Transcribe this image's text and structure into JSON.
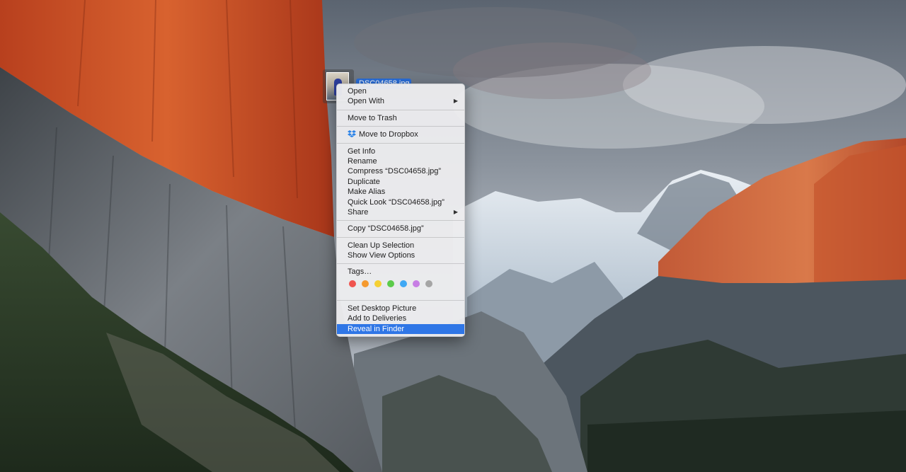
{
  "desktop": {
    "file_label": "DSC04658.jpg"
  },
  "context_menu": {
    "group1": [
      {
        "label": "Open",
        "arrow": ""
      },
      {
        "label": "Open With",
        "arrow": "▶"
      }
    ],
    "group2": [
      {
        "label": "Move to Trash"
      }
    ],
    "group3": [
      {
        "label": "Move to Dropbox",
        "icon": "dropbox-icon"
      }
    ],
    "group4": [
      {
        "label": "Get Info",
        "arrow": ""
      },
      {
        "label": "Rename",
        "arrow": ""
      },
      {
        "label": "Compress “DSC04658.jpg”",
        "arrow": ""
      },
      {
        "label": "Duplicate",
        "arrow": ""
      },
      {
        "label": "Make Alias",
        "arrow": ""
      },
      {
        "label": "Quick Look “DSC04658.jpg”",
        "arrow": ""
      },
      {
        "label": "Share",
        "arrow": "▶"
      }
    ],
    "group5": [
      {
        "label": "Copy “DSC04658.jpg”"
      }
    ],
    "group6": [
      {
        "label": "Clean Up Selection"
      },
      {
        "label": "Show View Options"
      }
    ],
    "group7": {
      "tags_label": "Tags…",
      "tag_colors": [
        "#f0544f",
        "#f59a2f",
        "#f5d033",
        "#5ccb4a",
        "#3fa8f4",
        "#c77ee4",
        "#a5a5a5"
      ]
    },
    "group8": [
      {
        "label": "Set Desktop Picture"
      },
      {
        "label": "Add to Deliveries"
      },
      {
        "label": "Reveal in Finder",
        "highlighted": true
      }
    ],
    "highlight_color": "#2f76e6"
  }
}
